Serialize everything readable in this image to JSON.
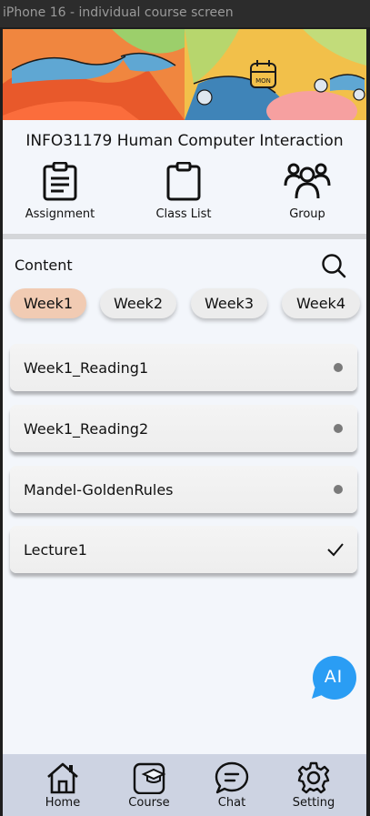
{
  "window": {
    "title": "iPhone 16 - individual course screen"
  },
  "banner": {
    "calendar_badge": "MON"
  },
  "course": {
    "title": "INFO31179 Human Computer Interaction"
  },
  "quick_actions": [
    {
      "label": "Assignment",
      "icon": "assignment-icon"
    },
    {
      "label": "Class List",
      "icon": "clipboard-icon"
    },
    {
      "label": "Group",
      "icon": "group-icon"
    }
  ],
  "content": {
    "label": "Content",
    "search_icon": "search-icon"
  },
  "weeks": [
    {
      "label": "Week1",
      "selected": true
    },
    {
      "label": "Week2",
      "selected": false
    },
    {
      "label": "Week3",
      "selected": false
    },
    {
      "label": "Week4",
      "selected": false
    }
  ],
  "items": [
    {
      "label": "Week1_Reading1",
      "status": "unread-dot"
    },
    {
      "label": "Week1_Reading2",
      "status": "unread-dot"
    },
    {
      "label": "Mandel-GoldenRules",
      "status": "unread-dot"
    },
    {
      "label": "Lecture1",
      "status": "check-icon"
    }
  ],
  "ai_button": {
    "label": "AI",
    "color": "#2a9df4"
  },
  "tabbar": [
    {
      "label": "Home",
      "icon": "home-icon"
    },
    {
      "label": "Course",
      "icon": "course-icon"
    },
    {
      "label": "Chat",
      "icon": "chat-icon"
    },
    {
      "label": "Setting",
      "icon": "gear-icon"
    }
  ],
  "colors": {
    "background": "#f3f6fb",
    "selected_week": "#f1cbb3",
    "chip": "#ececec",
    "tabbar": "#cdd3e2",
    "accent": "#2a9df4"
  }
}
